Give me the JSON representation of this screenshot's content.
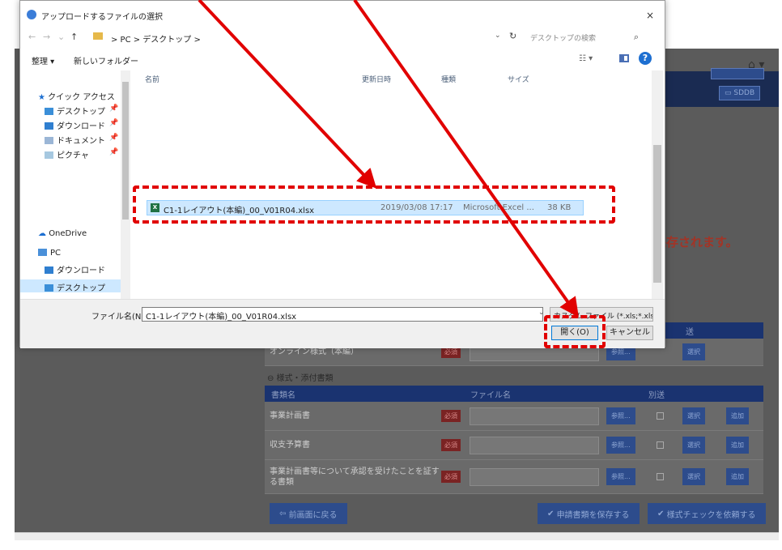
{
  "background": {
    "home_icon": "⌂ ▾",
    "header_button": "SDDB",
    "notice": "保存されます。",
    "section1": {
      "headers": {
        "name": "",
        "file": "",
        "separate": "送"
      },
      "rows": [
        {
          "name": "オンライン様式（本編）",
          "required": "必須",
          "ref": "参照...",
          "select": "選択"
        }
      ]
    },
    "section2_label": "⊖ 様式・添付書類",
    "section2": {
      "headers": {
        "name": "書類名",
        "file": "ファイル名",
        "separate": "別送"
      },
      "rows": [
        {
          "name": "事業計画書",
          "required": "必須",
          "ref": "参照...",
          "select": "選択",
          "add": "追加"
        },
        {
          "name": "収支予算書",
          "required": "必須",
          "ref": "参照...",
          "select": "選択",
          "add": "追加"
        },
        {
          "name": "事業計画書等について承認を受けたことを証する書類",
          "required": "必須",
          "ref": "参照...",
          "select": "選択",
          "add": "追加"
        }
      ]
    },
    "back_button": "前画面に戻る",
    "save_button": "申請書類を保存する",
    "check_button": "様式チェックを依頼する"
  },
  "dialog": {
    "title": "アップロードするファイルの選択",
    "close": "×",
    "path": "> PC > デスクトップ >",
    "search_placeholder": "デスクトップの検索",
    "toolbar": {
      "organize": "整理 ▾",
      "new_folder": "新しいフォルダー",
      "help": "?"
    },
    "nav": {
      "quick_access": "クイック アクセス",
      "quick_items": [
        "デスクトップ",
        "ダウンロード",
        "ドキュメント",
        "ピクチャ"
      ],
      "onedrive": "OneDrive",
      "pc": "PC",
      "pc_items": [
        "ダウンロード",
        "デスクトップ"
      ]
    },
    "columns": {
      "name": "名前",
      "date": "更新日時",
      "type": "種類",
      "size": "サイズ"
    },
    "file": {
      "name": "C1-1レイアウト(本編)_00_V01R04.xlsx",
      "date": "2019/03/08 17:17",
      "type": "Microsoft Excel ...",
      "size": "38 KB"
    },
    "filename_label": "ファイル名(N):",
    "filename_value": "C1-1レイアウト(本編)_00_V01R04.xlsx",
    "filetype": "カスタム ファイル (*.xls;*.xlsx;",
    "open_button": "開く(O)",
    "cancel_button": "キャンセル"
  },
  "colors": {
    "annotation": "#e10000",
    "dialog_selection": "#cde8ff",
    "bg_header": "#1a3370"
  }
}
